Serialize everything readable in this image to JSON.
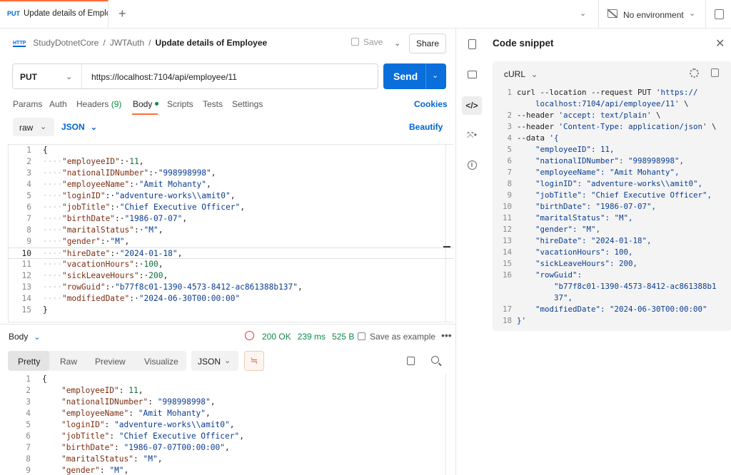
{
  "tab": {
    "method": "PUT",
    "title": "Update details of Emplo"
  },
  "environment": {
    "label": "No environment"
  },
  "breadcrumb": {
    "collection": "StudyDotnetCore",
    "folder": "JWTAuth",
    "request": "Update details of Employee",
    "http_badge": "HTTP"
  },
  "toolbar": {
    "save_label": "Save",
    "share_label": "Share"
  },
  "request": {
    "method": "PUT",
    "url": "https://localhost:7104/api/employee/11",
    "send_label": "Send"
  },
  "request_tabs": {
    "params": "Params",
    "auth": "Auth",
    "headers": "Headers",
    "headers_count": "(9)",
    "body": "Body",
    "scripts": "Scripts",
    "tests": "Tests",
    "settings": "Settings",
    "cookies": "Cookies"
  },
  "body_options": {
    "mode": "raw",
    "format": "JSON",
    "beautify": "Beautify"
  },
  "editor": {
    "current_line": 10,
    "lines": [
      {
        "n": "1",
        "text": "{"
      },
      {
        "n": "2",
        "key": "\"employeeID\"",
        "val": "11",
        "type": "num"
      },
      {
        "n": "3",
        "key": "\"nationalIDNumber\"",
        "val": "\"998998998\"",
        "type": "str"
      },
      {
        "n": "4",
        "key": "\"employeeName\"",
        "val": "\"Amit Mohanty\"",
        "type": "str"
      },
      {
        "n": "5",
        "key": "\"loginID\"",
        "val": "\"adventure-works\\\\amit0\"",
        "type": "str"
      },
      {
        "n": "6",
        "key": "\"jobTitle\"",
        "val": "\"Chief Executive Officer\"",
        "type": "str"
      },
      {
        "n": "7",
        "key": "\"birthDate\"",
        "val": "\"1986-07-07\"",
        "type": "str"
      },
      {
        "n": "8",
        "key": "\"maritalStatus\"",
        "val": "\"M\"",
        "type": "str"
      },
      {
        "n": "9",
        "key": "\"gender\"",
        "val": "\"M\"",
        "type": "str"
      },
      {
        "n": "10",
        "key": "\"hireDate\"",
        "val": "\"2024-01-18\"",
        "type": "str"
      },
      {
        "n": "11",
        "key": "\"vacationHours\"",
        "val": "100",
        "type": "num"
      },
      {
        "n": "12",
        "key": "\"sickLeaveHours\"",
        "val": "200",
        "type": "num"
      },
      {
        "n": "13",
        "key": "\"rowGuid\"",
        "val": "\"b77f8c01-1390-4573-8412-ac861388b137\"",
        "type": "str"
      },
      {
        "n": "14",
        "key": "\"modifiedDate\"",
        "val": "\"2024-06-30T00:00:00\"",
        "type": "str",
        "last": true
      },
      {
        "n": "15",
        "text": "}"
      }
    ]
  },
  "response": {
    "title": "Body",
    "status": "200 OK",
    "time": "239 ms",
    "size": "525 B",
    "save_example": "Save as example",
    "more": "•••",
    "views": {
      "pretty": "Pretty",
      "raw": "Raw",
      "preview": "Preview",
      "visualize": "Visualize"
    },
    "format": "JSON",
    "lines": [
      {
        "n": "1",
        "text": "{"
      },
      {
        "n": "2",
        "key": "\"employeeID\"",
        "val": "11",
        "type": "num"
      },
      {
        "n": "3",
        "key": "\"nationalIDNumber\"",
        "val": "\"998998998\"",
        "type": "str"
      },
      {
        "n": "4",
        "key": "\"employeeName\"",
        "val": "\"Amit Mohanty\"",
        "type": "str"
      },
      {
        "n": "5",
        "key": "\"loginID\"",
        "val": "\"adventure-works\\\\amit0\"",
        "type": "str"
      },
      {
        "n": "6",
        "key": "\"jobTitle\"",
        "val": "\"Chief Executive Officer\"",
        "type": "str"
      },
      {
        "n": "7",
        "key": "\"birthDate\"",
        "val": "\"1986-07-07T00:00:00\"",
        "type": "str"
      },
      {
        "n": "8",
        "key": "\"maritalStatus\"",
        "val": "\"M\"",
        "type": "str"
      },
      {
        "n": "9",
        "key": "\"gender\"",
        "val": "\"M\"",
        "type": "str"
      }
    ]
  },
  "code_snippet": {
    "title": "Code snippet",
    "language": "cURL",
    "lines": [
      {
        "n": "1",
        "parts": [
          [
            "cmd",
            "curl --location --request PUT "
          ],
          [
            "str",
            "'https://"
          ]
        ]
      },
      {
        "n": "",
        "parts": [
          [
            "str",
            "    localhost:7104/api/employee/11'"
          ],
          [
            "cmd",
            " \\"
          ]
        ]
      },
      {
        "n": "2",
        "parts": [
          [
            "cmd",
            "--header "
          ],
          [
            "str",
            "'accept: text/plain'"
          ],
          [
            "cmd",
            " \\"
          ]
        ]
      },
      {
        "n": "3",
        "parts": [
          [
            "cmd",
            "--header "
          ],
          [
            "str",
            "'Content-Type: application/json'"
          ],
          [
            "cmd",
            " \\"
          ]
        ]
      },
      {
        "n": "4",
        "parts": [
          [
            "cmd",
            "--data "
          ],
          [
            "str",
            "'{"
          ]
        ]
      },
      {
        "n": "5",
        "parts": [
          [
            "str",
            "    \"employeeID\": 11,"
          ]
        ]
      },
      {
        "n": "6",
        "parts": [
          [
            "str",
            "    \"nationalIDNumber\": \"998998998\","
          ]
        ]
      },
      {
        "n": "7",
        "parts": [
          [
            "str",
            "    \"employeeName\": \"Amit Mohanty\","
          ]
        ]
      },
      {
        "n": "8",
        "parts": [
          [
            "str",
            "    \"loginID\": \"adventure-works\\\\amit0\","
          ]
        ]
      },
      {
        "n": "9",
        "parts": [
          [
            "str",
            "    \"jobTitle\": \"Chief Executive Officer\","
          ]
        ]
      },
      {
        "n": "10",
        "parts": [
          [
            "str",
            "    \"birthDate\": \"1986-07-07\","
          ]
        ]
      },
      {
        "n": "11",
        "parts": [
          [
            "str",
            "    \"maritalStatus\": \"M\","
          ]
        ]
      },
      {
        "n": "12",
        "parts": [
          [
            "str",
            "    \"gender\": \"M\","
          ]
        ]
      },
      {
        "n": "13",
        "parts": [
          [
            "str",
            "    \"hireDate\": \"2024-01-18\","
          ]
        ]
      },
      {
        "n": "14",
        "parts": [
          [
            "str",
            "    \"vacationHours\": 100,"
          ]
        ]
      },
      {
        "n": "15",
        "parts": [
          [
            "str",
            "    \"sickLeaveHours\": 200,"
          ]
        ]
      },
      {
        "n": "16",
        "parts": [
          [
            "str",
            "    \"rowGuid\":"
          ]
        ]
      },
      {
        "n": "",
        "parts": [
          [
            "str",
            "        \"b77f8c01-1390-4573-8412-ac861388b1"
          ]
        ]
      },
      {
        "n": "",
        "parts": [
          [
            "str",
            "        37\","
          ]
        ]
      },
      {
        "n": "17",
        "parts": [
          [
            "str",
            "    \"modifiedDate\": \"2024-06-30T00:00:00\""
          ]
        ]
      },
      {
        "n": "18",
        "parts": [
          [
            "str",
            "}'"
          ]
        ]
      }
    ]
  },
  "colors": {
    "accent": "#ff6c37",
    "send": "#0a6fdb",
    "success": "#0e8a45",
    "link": "#0265d2"
  }
}
